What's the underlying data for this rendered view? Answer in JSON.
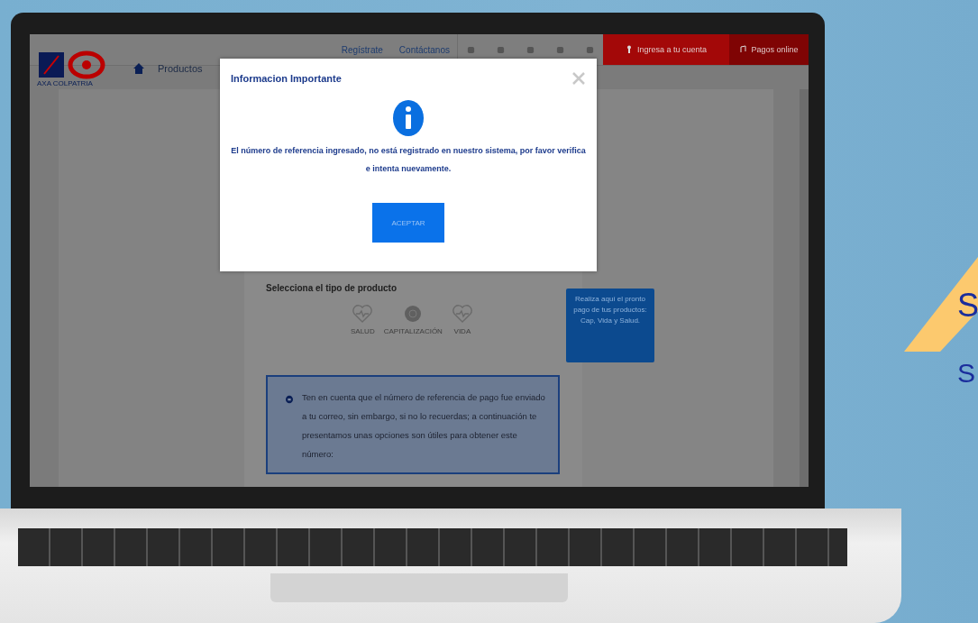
{
  "header": {
    "logo_text": "AXA COLPATRIA",
    "top_links": [
      "Regístrate",
      "Contáctanos"
    ],
    "account_button": "Ingresa a tu cuenta",
    "payments_button": "Pagos online",
    "nav_item": "Productos"
  },
  "content": {
    "section_title": "Selecciona el tipo de producto",
    "products": [
      {
        "label": "SALUD",
        "kind": "heart"
      },
      {
        "label": "CAPITALIZACIÓN",
        "kind": "coin"
      },
      {
        "label": "VIDA",
        "kind": "heart"
      }
    ],
    "tooltip": "Realiza aquí el pronto pago de tus productos: Cap, Vida y Salud.",
    "notice": "Ten en cuenta que el número de referencia de pago fue enviado a tu correo, sin embargo, si no lo recuerdas; a continuación te presentamos unas opciones son útiles para obtener este número:"
  },
  "modal": {
    "title": "Informacion Importante",
    "message": "El número de referencia ingresado, no está registrado en nuestro sistema, por favor verifica e intenta nuevamente.",
    "button": "ACEPTAR"
  },
  "side_text": [
    "S",
    "S"
  ]
}
